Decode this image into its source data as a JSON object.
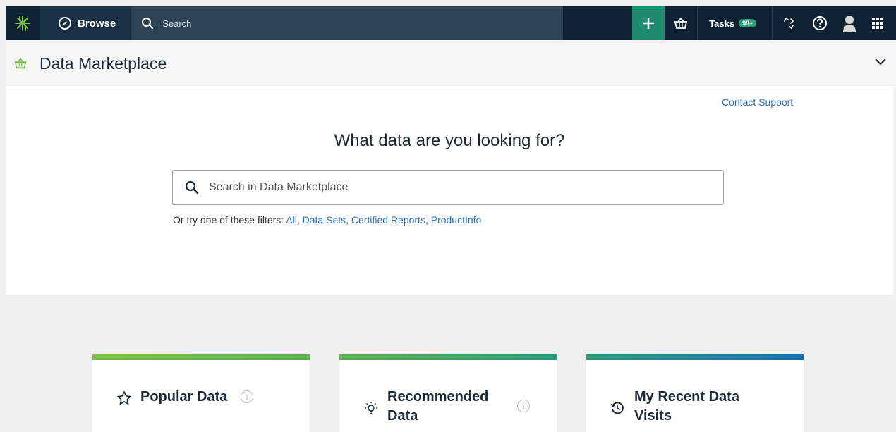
{
  "topbar": {
    "browse_label": "Browse",
    "search_placeholder": "Search",
    "tasks_label": "Tasks",
    "tasks_badge": "99+"
  },
  "header": {
    "title": "Data Marketplace"
  },
  "hero": {
    "contact_link": "Contact Support",
    "heading": "What data are you looking for?",
    "search_placeholder": "Search in Data Marketplace",
    "filters_prefix": "Or try one of these filters: ",
    "filters": [
      "All",
      "Data Sets",
      "Certified Reports",
      "ProductInfo"
    ]
  },
  "cards": [
    {
      "title": "Popular Data",
      "icon": "star-icon",
      "accent": "#7ac143"
    },
    {
      "title_line1": "Recommended",
      "title_line2": "Data",
      "icon": "lightbulb-icon"
    },
    {
      "title_line1": "My Recent Data",
      "title_line2": "Visits",
      "icon": "history-icon"
    }
  ],
  "colors": {
    "topbar": "#0f2233",
    "accent_green": "#1f8a6e",
    "link": "#2a6fb5"
  }
}
